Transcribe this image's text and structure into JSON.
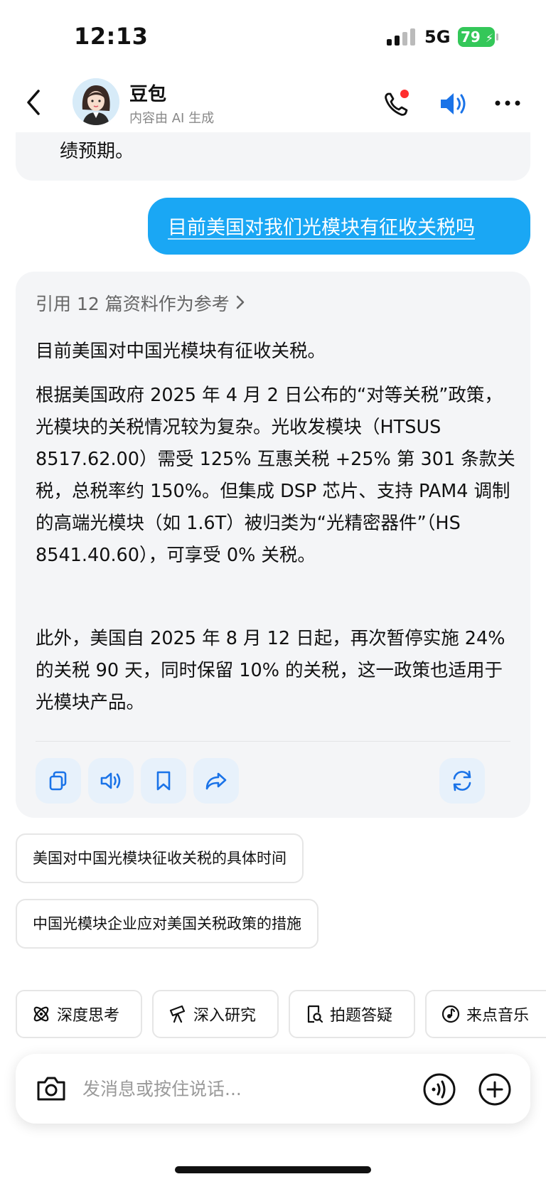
{
  "status_bar": {
    "time": "12:13",
    "network": "5G",
    "battery": "79"
  },
  "header": {
    "name": "豆包",
    "subtitle": "内容由 AI 生成"
  },
  "previous_message_tail": "绩预期。",
  "user_message": "目前美国对我们光模块有征收关税吗",
  "answer": {
    "references": "引用 12 篇资料作为参考",
    "paragraphs": [
      "目前美国对中国光模块有征收关税。",
      "根据美国政府 2025 年 4 月 2 日公布的“对等关税”政策，光模块的关税情况较为复杂。光收发模块（HTSUS 8517.62.00）需受 125% 互惠关税 +25% 第 301 条款关税，总税率约 150%。但集成 DSP 芯片、支持 PAM4 调制的高端光模块（如 1.6T）被归类为“光精密器件”（HS 8541.40.60），可享受 0% 关税。",
      "此外，美国自 2025 年 8 月 12 日起，再次暂停实施 24% 的关税 90 天，同时保留 10% 的关税，这一政策也适用于光模块产品。"
    ],
    "actions": [
      "copy-icon",
      "speaker-icon",
      "bookmark-icon",
      "share-icon",
      "regenerate-icon"
    ]
  },
  "suggestions": [
    "美国对中国光模块征收关税的具体时间",
    "中国光模块企业应对美国关税政策的措施"
  ],
  "tools": [
    "深度思考",
    "深入研究",
    "拍题答疑",
    "来点音乐"
  ],
  "input": {
    "placeholder": "发消息或按住说话..."
  },
  "colors": {
    "accent": "#1aa7f4",
    "icon_blue": "#1a73e8",
    "battery": "#34c759"
  }
}
